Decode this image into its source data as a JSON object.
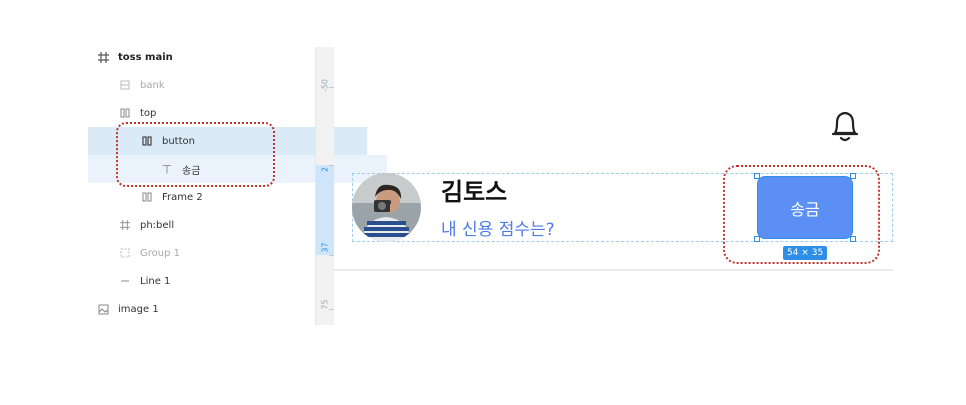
{
  "layers_panel": {
    "items": [
      {
        "label": "toss main",
        "icon": "frame-icon"
      },
      {
        "label": "bank",
        "icon": "component-icon"
      },
      {
        "label": "top",
        "icon": "autolayout-icon"
      },
      {
        "label": "button",
        "icon": "autolayout-icon"
      },
      {
        "label": "송금",
        "icon": "text-icon"
      },
      {
        "label": "Frame 2",
        "icon": "autolayout-icon"
      },
      {
        "label": "ph:bell",
        "icon": "frame-icon"
      },
      {
        "label": "Group 1",
        "icon": "group-icon"
      },
      {
        "label": "Line 1",
        "icon": "line-icon"
      },
      {
        "label": "image 1",
        "icon": "image-icon"
      }
    ]
  },
  "ruler": {
    "labels": [
      "-50",
      "2",
      "37",
      "75"
    ]
  },
  "canvas": {
    "name": "김토스",
    "subtitle": "내 신용 점수는?",
    "button_label": "송금",
    "size_badge": "54 × 35"
  },
  "colors": {
    "accent": "#2f8fe8",
    "button": "#5b8ff3",
    "subtitle": "#4f7ce6",
    "annotation": "#c0342c",
    "selection": "#daeaf7"
  }
}
